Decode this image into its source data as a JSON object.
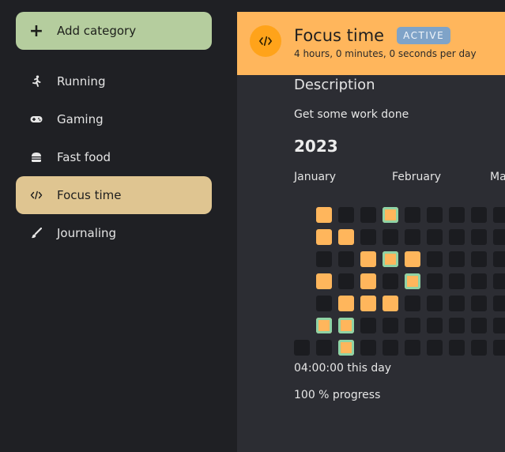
{
  "sidebar": {
    "add_label": "Add category",
    "items": [
      {
        "label": "Running",
        "icon": "running-icon"
      },
      {
        "label": "Gaming",
        "icon": "gamepad-icon"
      },
      {
        "label": "Fast food",
        "icon": "burger-icon"
      },
      {
        "label": "Focus time",
        "icon": "code-icon",
        "selected": true
      },
      {
        "label": "Journaling",
        "icon": "brush-icon"
      }
    ]
  },
  "header": {
    "title": "Focus time",
    "badge": "ACTIVE",
    "subtitle": "4 hours, 0 minutes, 0 seconds per day"
  },
  "content": {
    "description_title": "Description",
    "description": "Get some work done",
    "year": "2023",
    "months": [
      "January",
      "February",
      "Ma"
    ],
    "day_stat": "04:00:00 this day",
    "progress_stat": "100 % progress"
  },
  "colors": {
    "accent": "#ffb65c",
    "selected": "#dfc591",
    "add": "#b5cd9e",
    "badge": "#7fa3c8",
    "completed_outline": "#8fd3a5"
  },
  "heatmap": {
    "columns": 10,
    "rows": 7,
    "weeks": [
      [
        "none",
        "none",
        "none",
        "none",
        "none",
        "none",
        "empty"
      ],
      [
        "done",
        "done",
        "empty",
        "done",
        "empty",
        "completed",
        "empty"
      ],
      [
        "empty",
        "done",
        "empty",
        "empty",
        "done",
        "completed",
        "completed"
      ],
      [
        "empty",
        "empty",
        "done",
        "done",
        "done",
        "empty",
        "empty"
      ],
      [
        "completed",
        "empty",
        "completed",
        "empty",
        "done",
        "empty",
        "empty"
      ],
      [
        "empty",
        "empty",
        "done",
        "completed",
        "empty",
        "empty",
        "empty"
      ],
      [
        "empty",
        "empty",
        "empty",
        "empty",
        "empty",
        "empty",
        "empty"
      ],
      [
        "empty",
        "empty",
        "empty",
        "empty",
        "empty",
        "empty",
        "empty"
      ],
      [
        "empty",
        "empty",
        "empty",
        "empty",
        "empty",
        "empty",
        "empty"
      ],
      [
        "empty",
        "empty",
        "empty",
        "empty",
        "empty",
        "empty",
        "empty"
      ]
    ]
  }
}
